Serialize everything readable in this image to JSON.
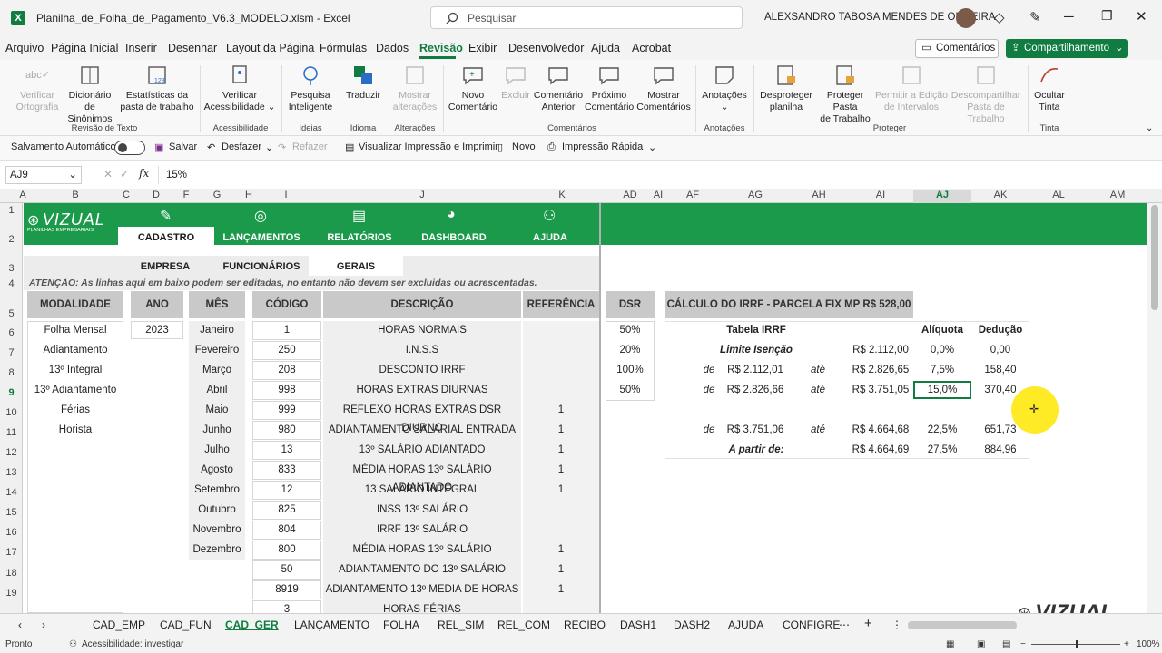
{
  "titlebar": {
    "filename": "Planilha_de_Folha_de_Pagamento_V6.3_MODELO.xlsm",
    "separator": "-",
    "app": "Excel",
    "search_placeholder": "Pesquisar",
    "user": "ALEXSANDRO TABOSA MENDES DE OLIVEIRA"
  },
  "menu": [
    "Arquivo",
    "Página Inicial",
    "Inserir",
    "Desenhar",
    "Layout da Página",
    "Fórmulas",
    "Dados",
    "Revisão",
    "Exibir",
    "Desenvolvedor",
    "Ajuda",
    "Acrobat"
  ],
  "menu_active": "Revisão",
  "comments_btn": "Comentários",
  "share_btn": "Compartilhamento",
  "ribbon": {
    "buttons": [
      {
        "label": "Verificar\nOrtografia",
        "disabled": true
      },
      {
        "label": "Dicionário\nde Sinônimos",
        "disabled": false
      },
      {
        "label": "Estatísticas da\npasta de trabalho",
        "disabled": false
      },
      {
        "label": "Verificar\nAcessibilidade",
        "disabled": false
      },
      {
        "label": "Pesquisa\nInteligente",
        "disabled": false
      },
      {
        "label": "Traduzir",
        "disabled": false
      },
      {
        "label": "Mostrar\nalterações",
        "disabled": true
      },
      {
        "label": "Novo\nComentário",
        "disabled": false
      },
      {
        "label": "Excluir",
        "disabled": true
      },
      {
        "label": "Comentário\nAnterior",
        "disabled": false
      },
      {
        "label": "Próximo\nComentário",
        "disabled": false
      },
      {
        "label": "Mostrar\nComentários",
        "disabled": false
      },
      {
        "label": "Anotações",
        "disabled": false
      },
      {
        "label": "Desproteger\nplanilha",
        "disabled": false
      },
      {
        "label": "Proteger Pasta\nde Trabalho",
        "disabled": false
      },
      {
        "label": "Permitir a Edição\nde Intervalos",
        "disabled": true
      },
      {
        "label": "Descompartilhar\nPasta de Trabalho",
        "disabled": true
      },
      {
        "label": "Ocultar\nTinta",
        "disabled": false
      }
    ],
    "groups": [
      "Revisão de Texto",
      "Acessibilidade",
      "Ideias",
      "Idioma",
      "Alterações",
      "Comentários",
      "Anotações",
      "Proteger",
      "Tinta"
    ]
  },
  "qat": {
    "autosave": "Salvamento Automático",
    "save": "Salvar",
    "undo": "Desfazer",
    "redo": "Refazer",
    "print_preview": "Visualizar Impressão e Imprimir",
    "new": "Novo",
    "quick_print": "Impressão Rápida"
  },
  "formula_bar": {
    "cell_ref": "AJ9",
    "fx": "fx",
    "value": "15%"
  },
  "col_headers": [
    "A",
    "B",
    "C",
    "D",
    "F",
    "G",
    "H",
    "I",
    "J",
    "K",
    "AD",
    "AI",
    "AF",
    "AG",
    "AH",
    "AI",
    "AJ",
    "AK",
    "AL",
    "AM"
  ],
  "row_numbers": [
    "1",
    "2",
    "3",
    "4",
    "5",
    "6",
    "7",
    "8",
    "9",
    "10",
    "11",
    "12",
    "13",
    "14",
    "15",
    "16",
    "17",
    "18",
    "19"
  ],
  "brand": {
    "name": "VIZUAL",
    "sub": "PLANILHAS EMPRESARIAIS"
  },
  "nav": [
    "CADASTRO",
    "LANÇAMENTOS",
    "RELATÓRIOS",
    "DASHBOARD",
    "AJUDA"
  ],
  "subnav": [
    "EMPRESA",
    "FUNCIONÁRIOS",
    "GERAIS"
  ],
  "warning": "ATENÇÃO: As linhas aqui em baixo podem ser editadas, no entanto não devem ser excluidas ou acrescentadas.",
  "headers": {
    "modalidade": "MODALIDADE",
    "ano": "ANO",
    "mes": "MÊS",
    "codigo": "CÓDIGO",
    "descricao": "DESCRIÇÃO",
    "referencia": "REFERÊNCIA",
    "dsr": "DSR",
    "irrf": "CÁLCULO DO IRRF - PARCELA FIX MP R$ 528,00"
  },
  "modalidades": [
    "Folha Mensal",
    "Adiantamento",
    "13º Integral",
    "13º Adiantamento",
    "Férias",
    "Horista"
  ],
  "ano": "2023",
  "meses": [
    "Janeiro",
    "Fevereiro",
    "Março",
    "Abril",
    "Maio",
    "Junho",
    "Julho",
    "Agosto",
    "Setembro",
    "Outubro",
    "Novembro",
    "Dezembro"
  ],
  "codigos": [
    {
      "cod": "1",
      "desc": "HORAS NORMAIS",
      "ref": ""
    },
    {
      "cod": "250",
      "desc": "I.N.S.S",
      "ref": ""
    },
    {
      "cod": "208",
      "desc": "DESCONTO IRRF",
      "ref": ""
    },
    {
      "cod": "998",
      "desc": "HORAS EXTRAS DIURNAS",
      "ref": ""
    },
    {
      "cod": "999",
      "desc": "REFLEXO HORAS EXTRAS DSR DIURNO",
      "ref": "1"
    },
    {
      "cod": "980",
      "desc": "ADIANTAMENTO SALARIAL ENTRADA",
      "ref": "1"
    },
    {
      "cod": "13",
      "desc": "13º SALÁRIO ADIANTADO",
      "ref": "1"
    },
    {
      "cod": "833",
      "desc": "MÉDIA HORAS 13º SALÁRIO ADIANTADO",
      "ref": "1"
    },
    {
      "cod": "12",
      "desc": "13 SALÁRIO INTEGRAL",
      "ref": "1"
    },
    {
      "cod": "825",
      "desc": "INSS 13º SALÁRIO",
      "ref": ""
    },
    {
      "cod": "804",
      "desc": "IRRF 13º SALÁRIO",
      "ref": ""
    },
    {
      "cod": "800",
      "desc": "MÉDIA HORAS 13º SALÁRIO",
      "ref": "1"
    },
    {
      "cod": "50",
      "desc": "ADIANTAMENTO DO 13º SALÁRIO",
      "ref": "1"
    },
    {
      "cod": "8919",
      "desc": "ADIANTAMENTO 13º MEDIA DE HORAS",
      "ref": "1"
    },
    {
      "cod": "3",
      "desc": "HORAS FÉRIAS",
      "ref": ""
    }
  ],
  "dsr": [
    "50%",
    "20%",
    "100%",
    "50%"
  ],
  "irrf_table": {
    "title": "Tabela IRRF",
    "aliquota": "Alíquota",
    "deducao": "Dedução",
    "isencao": "Limite Isenção",
    "isencao_val": "R$  2.112,00",
    "isencao_aliq": "0,0%",
    "isencao_ded": "0,00",
    "rows": [
      {
        "de": "de",
        "from": "R$  2.112,01",
        "ate": "até",
        "to": "R$  2.826,65",
        "aliq": "7,5%",
        "ded": "158,40"
      },
      {
        "de": "de",
        "from": "R$  2.826,66",
        "ate": "até",
        "to": "R$  3.751,05",
        "aliq": "15,0%",
        "ded": "370,40"
      },
      {
        "de": "de",
        "from": "R$  3.751,06",
        "ate": "até",
        "to": "R$  4.664,68",
        "aliq": "22,5%",
        "ded": "651,73"
      }
    ],
    "apartir": "A partir de:",
    "apartir_val": "R$  4.664,69",
    "apartir_aliq": "27,5%",
    "apartir_ded": "884,96"
  },
  "sheet_tabs": [
    "CAD_EMP",
    "CAD_FUN",
    "CAD_GER",
    "LANÇAMENTO",
    "FOLHA",
    "REL_SIM",
    "REL_COM",
    "RECIBO",
    "DASH1",
    "DASH2",
    "AJUDA",
    "CONFIGRE"
  ],
  "sheet_active": "CAD_GER",
  "status": {
    "ready": "Pronto",
    "accessibility": "Acessibilidade: investigar",
    "zoom": "100%"
  },
  "watermark": "VIZUAL",
  "colors": {
    "green": "#1a9a4a",
    "excel": "#107c41",
    "header_gray": "#c9c9c9",
    "cursor": "#ffe600"
  }
}
